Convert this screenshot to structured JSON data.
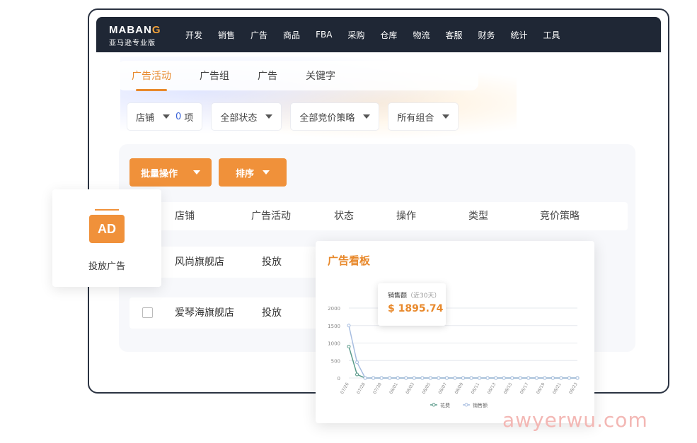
{
  "brand": {
    "logo_text": "MABAN",
    "logo_accent": "G",
    "subtitle": "亚马逊专业版",
    "accent_color": "#f0913a",
    "nav_bg": "#1f2735"
  },
  "nav": {
    "items": [
      "开发",
      "销售",
      "广告",
      "商品",
      "FBA",
      "采购",
      "仓库",
      "物流",
      "客服",
      "财务",
      "统计",
      "工具"
    ]
  },
  "tabs": [
    {
      "label": "广告活动",
      "active": true
    },
    {
      "label": "广告组",
      "active": false
    },
    {
      "label": "广告",
      "active": false
    },
    {
      "label": "关键字",
      "active": false
    }
  ],
  "filters": {
    "store_label": "店铺",
    "count_value": "0",
    "count_unit": "项",
    "status": "全部状态",
    "bidding": "全部竞价策略",
    "portfolio": "所有组合"
  },
  "actions": {
    "batch": "批量操作",
    "sort": "排序"
  },
  "table": {
    "headers": [
      "店铺",
      "广告活动",
      "状态",
      "操作",
      "类型",
      "竞价策略"
    ],
    "rows": [
      {
        "store": "风尚旗舰店",
        "campaign": "投放"
      },
      {
        "store": "爱琴海旗舰店",
        "campaign": "投放"
      }
    ]
  },
  "ad_card": {
    "icon_text": "AD",
    "label": "投放广告"
  },
  "dashboard": {
    "title": "广告看板",
    "tooltip": {
      "label": "销售额",
      "sub": "（近30天）",
      "value": "$ 1895.74"
    }
  },
  "chart_data": {
    "type": "line",
    "x": [
      "07/26",
      "07/27",
      "07/28",
      "07/29",
      "07/30",
      "07/31",
      "08/01",
      "08/02",
      "08/03",
      "08/04",
      "08/05",
      "08/06",
      "08/07",
      "08/08",
      "08/09",
      "08/10",
      "08/11",
      "08/12",
      "08/13",
      "08/14",
      "08/15",
      "08/16",
      "08/17",
      "08/18",
      "08/19",
      "08/20",
      "08/21",
      "08/22",
      "08/23"
    ],
    "x_ticks": [
      "07/26",
      "07/28",
      "07/30",
      "08/01",
      "08/03",
      "08/05",
      "08/07",
      "08/09",
      "08/11",
      "08/13",
      "08/15",
      "08/17",
      "08/19",
      "08/21",
      "08/23"
    ],
    "series": [
      {
        "name": "花费",
        "color": "#5a9a8a",
        "values": [
          900,
          100,
          0,
          0,
          0,
          0,
          0,
          0,
          0,
          0,
          0,
          0,
          0,
          0,
          0,
          0,
          0,
          0,
          0,
          0,
          0,
          0,
          0,
          0,
          0,
          0,
          0,
          0,
          0
        ]
      },
      {
        "name": "销售额",
        "color": "#a7bde0",
        "values": [
          1500,
          450,
          0,
          0,
          0,
          0,
          0,
          0,
          0,
          0,
          0,
          0,
          0,
          0,
          0,
          0,
          0,
          0,
          0,
          0,
          0,
          0,
          0,
          0,
          0,
          0,
          0,
          0,
          0
        ]
      }
    ],
    "y_ticks": [
      0,
      500,
      1000,
      1500,
      2000
    ],
    "ylim": [
      0,
      2000
    ],
    "grid": true,
    "legend": "bottom"
  },
  "watermark": "awyerwu.com"
}
